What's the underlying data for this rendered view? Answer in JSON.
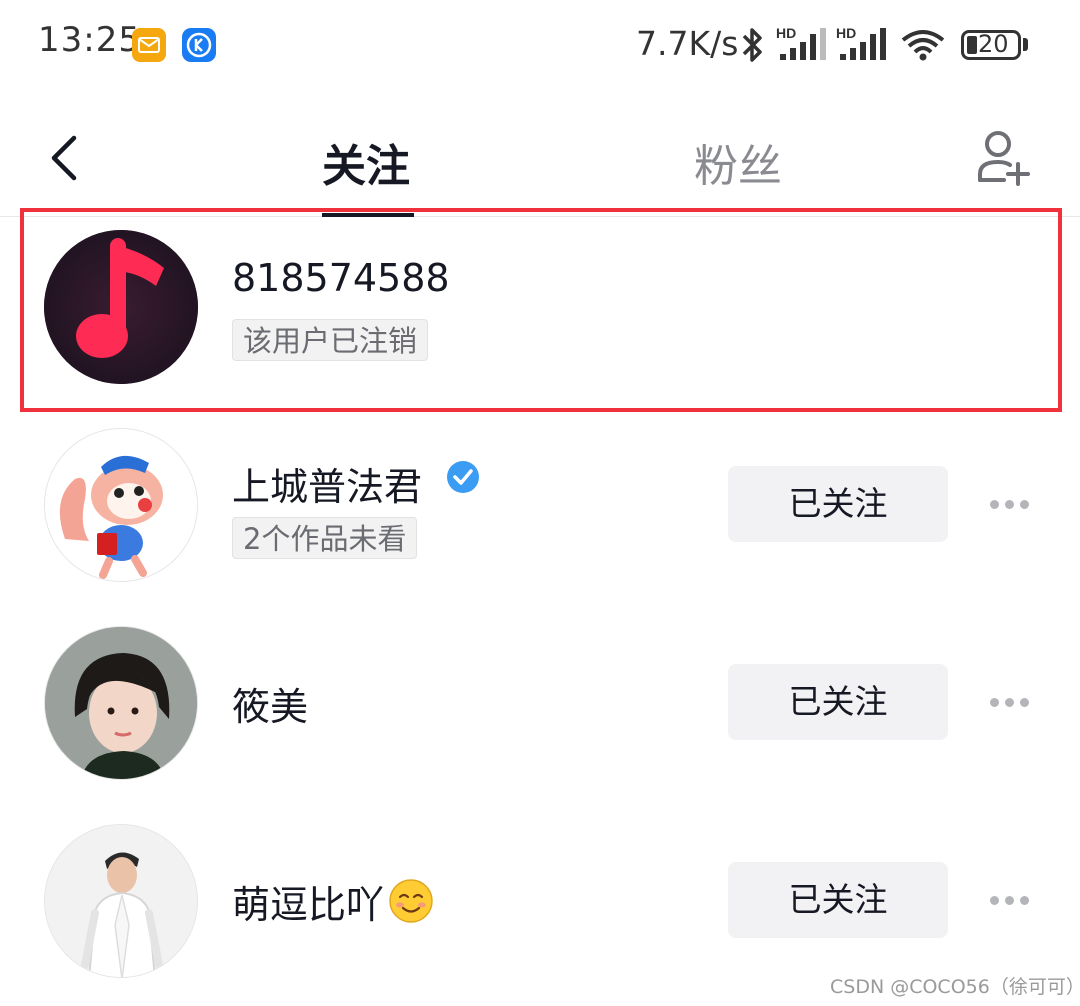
{
  "status_bar": {
    "time": "13:25",
    "network_speed": "7.7K/s",
    "battery": "20",
    "signal_badge_1": "HD",
    "signal_badge_2": "HD",
    "icons": [
      "mail-icon",
      "k-app-icon",
      "bluetooth-icon",
      "signal-icon",
      "wifi-icon",
      "battery-icon"
    ]
  },
  "header": {
    "back_icon": "chevron-left-icon",
    "tabs": [
      {
        "label": "关注",
        "active": true
      },
      {
        "label": "粉丝",
        "active": false
      }
    ],
    "add_friend_icon": "add-user-icon"
  },
  "list": [
    {
      "name": "818574588",
      "tag": "该用户已注销",
      "highlighted": true
    },
    {
      "name": "上城普法君",
      "verified": true,
      "tag": "2个作品未看",
      "button": "已关注"
    },
    {
      "name": "筱美",
      "button": "已关注"
    },
    {
      "name": "萌逗比吖",
      "emoji": "smiling-face-icon",
      "button": "已关注"
    }
  ],
  "colors": {
    "highlight_border": "#f0323c",
    "verified_blue": "#3b9cf3",
    "music_icon": "#fe2c55"
  },
  "watermark": "CSDN @COCO56（徐可可）"
}
